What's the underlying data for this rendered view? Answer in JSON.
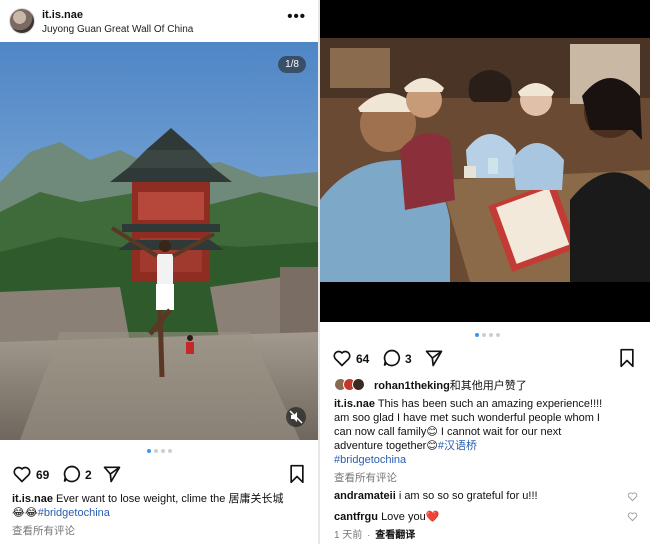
{
  "left_post": {
    "username": "it.is.nae",
    "location": "Juyong Guan Great Wall Of China",
    "counter": "1/8",
    "likes": "69",
    "comments": "2",
    "caption_user": "it.is.nae",
    "caption_text": "Ever want to lose weight, clime the 居庸关长城",
    "caption_emoji": "😂😂",
    "hashtag": "#bridgetochina",
    "view_comments": "查看所有评论"
  },
  "right_post": {
    "likes": "64",
    "comments": "3",
    "liked_by_user": "rohan1theking",
    "liked_by_suffix": "和其他用户赞了",
    "caption_user": "it.is.nae",
    "caption_line1": "This has been such an amazing experience!!!!",
    "caption_line2": "am soo glad I have met such wonderful people whom I",
    "caption_line3a": "can now call family",
    "caption_line3b": " I cannot wait for our next",
    "caption_line4a": "adventure together",
    "caption_line4b": "#汉语桥",
    "emoji_smile": "😊",
    "hashtag": "#bridgetochina",
    "view_comments": "查看所有评论",
    "comment1_user": "andramateii",
    "comment1_text": "i am so so so grateful for u!!!",
    "comment2_user": "cantfrgu",
    "comment2_text": "Love you",
    "comment2_emoji": "❤️",
    "time": "1 天前",
    "translate": "查看翻译"
  },
  "icons": [
    "more-icon",
    "heart-icon",
    "comment-icon",
    "share-icon",
    "bookmark-icon",
    "mute-icon"
  ],
  "colors": {
    "hashtag": "#2a5db0",
    "active_dot": "#3897f0"
  }
}
